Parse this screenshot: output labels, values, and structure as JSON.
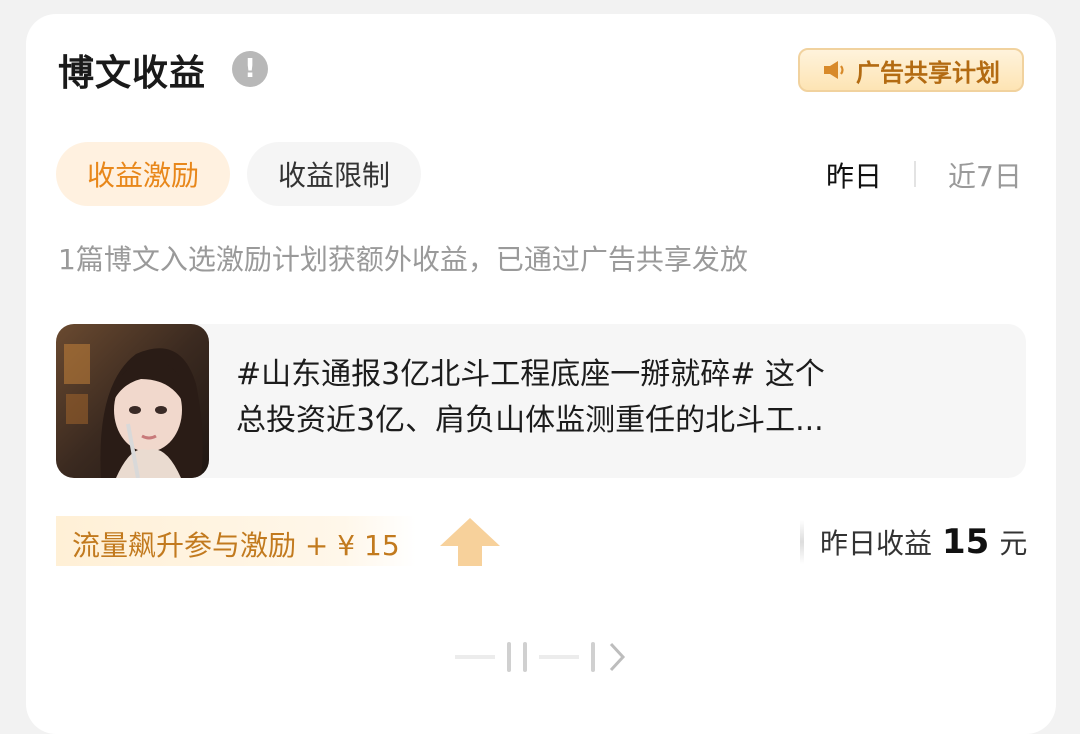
{
  "header": {
    "title": "博文收益",
    "info_icon": "exclamation-circle-icon",
    "ad_badge_label": "广告共享计划",
    "ad_badge_icon": "megaphone-icon"
  },
  "tabs": [
    {
      "label": "收益激励",
      "active": true
    },
    {
      "label": "收益限制",
      "active": false
    }
  ],
  "range": {
    "yesterday": "昨日",
    "last7": "近7日",
    "selected": "昨日"
  },
  "description": "1篇博文入选激励计划获额外收益，已通过广告共享发放",
  "post": {
    "line1": "#山东通报3亿北斗工程底座一掰就碎# 这个",
    "line2": "总投资近3亿、肩负山体监测重任的北斗工..."
  },
  "boost": {
    "label": "流量飙升参与激励",
    "amount": "+ ¥ 15"
  },
  "earnings": {
    "label": "昨日收益",
    "value": "15",
    "unit": "元"
  },
  "colors": {
    "accent": "#e8871a",
    "badge_text": "#b36b12",
    "muted": "#9a9a9a",
    "card": "#ffffff",
    "background": "#f2f2f2"
  }
}
